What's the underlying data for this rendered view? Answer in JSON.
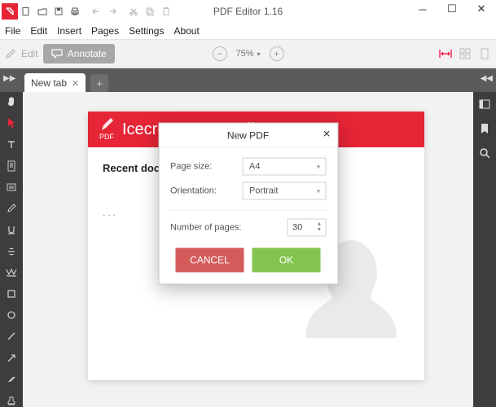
{
  "app": {
    "title": "PDF Editor 1.16"
  },
  "menubar": [
    "File",
    "Edit",
    "Insert",
    "Pages",
    "Settings",
    "About"
  ],
  "toolbar": {
    "edit_label": "Edit",
    "annotate_label": "Annotate",
    "zoom_level": "75%"
  },
  "tabstrip": {
    "tab_label": "New tab"
  },
  "page": {
    "header_product": "Icecream PDF Editor",
    "header_badge": "PDF",
    "recent_label": "Recent documents"
  },
  "dialog": {
    "title": "New PDF",
    "page_size_label": "Page size:",
    "page_size_value": "A4",
    "orientation_label": "Orientation:",
    "orientation_value": "Portrait",
    "num_pages_label": "Number of pages:",
    "num_pages_value": "30",
    "cancel_label": "CANCEL",
    "ok_label": "OK"
  },
  "left_tools": [
    "hand-icon",
    "cursor-icon",
    "text-icon",
    "page-icon",
    "notes-icon",
    "pencil-icon",
    "underline-icon",
    "strike-icon",
    "wave-icon",
    "square-icon",
    "circle-icon",
    "line-icon",
    "arrow-icon",
    "eraser-icon",
    "stamp-icon"
  ],
  "right_tools": [
    "panel-icon",
    "bookmark-icon",
    "search-icon"
  ]
}
